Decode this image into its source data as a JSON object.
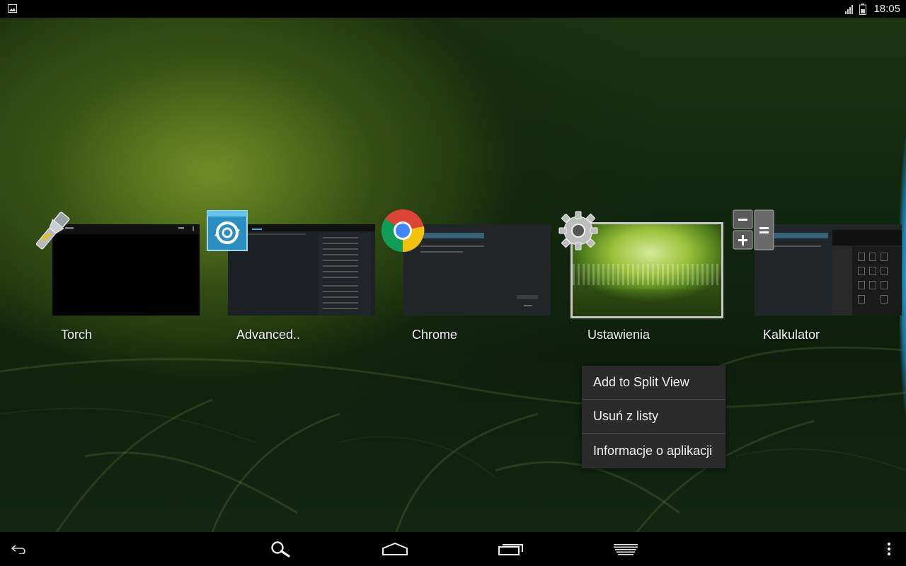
{
  "status_bar": {
    "time": "18:05",
    "icons": [
      "image-notification-icon",
      "signal-icon",
      "battery-icon"
    ]
  },
  "recent_apps": [
    {
      "label": "Torch",
      "icon": "flashlight-icon",
      "selected": false
    },
    {
      "label": "Advanced..",
      "icon": "sync-gear-icon",
      "selected": false
    },
    {
      "label": "Chrome",
      "icon": "chrome-icon",
      "selected": false
    },
    {
      "label": "Ustawienia",
      "icon": "settings-gear-icon",
      "selected": true
    },
    {
      "label": "Kalkulator",
      "icon": "calculator-icon",
      "selected": false
    }
  ],
  "context_menu": {
    "items": [
      "Add to Split View",
      "Usuń z listy",
      "Informacje o aplikacji"
    ]
  },
  "nav_bar": {
    "buttons": [
      "back-icon",
      "search-icon",
      "home-icon",
      "recent-apps-icon",
      "menu-lines-icon",
      "overflow-icon"
    ]
  },
  "colors": {
    "menu_bg": "#2b2b2b",
    "selected_border": "#c9c9c9",
    "accent_blue": "#33b5e5"
  }
}
